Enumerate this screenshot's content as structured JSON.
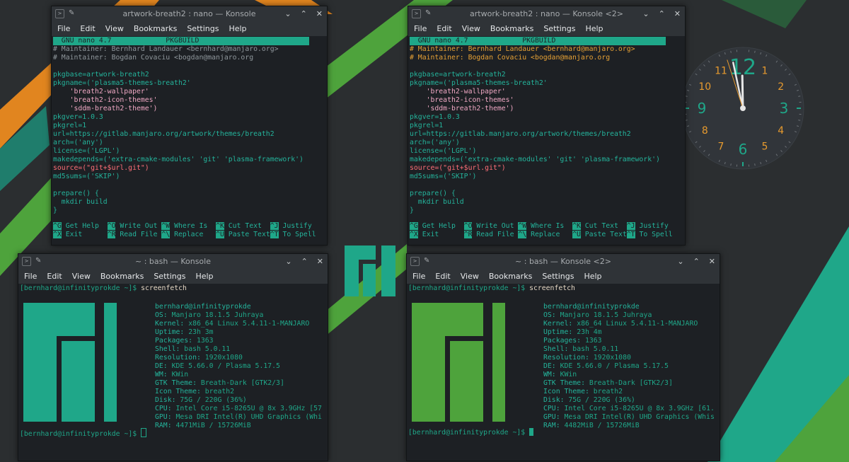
{
  "colors": {
    "teal": "#1fa789",
    "green": "#4ea33c",
    "orange": "#e1851f",
    "dark_bg": "#2b2e30",
    "terminal_bg": "#1d2024",
    "clock_orange": "#e79a2e"
  },
  "windows": [
    {
      "id": "nano1",
      "title": "artwork-breath2 : nano — Konsole",
      "menu": [
        "File",
        "Edit",
        "View",
        "Bookmarks",
        "Settings",
        "Help"
      ],
      "nano_header": "  GNU nano 4.7             PKGBUILD",
      "lines": [
        "# Maintainer: Bernhard Landauer <bernhard@manjaro.org>",
        "# Maintainer: Bogdan Covaciu <bogdan@manjaro.org",
        "",
        "pkgbase=artwork-breath2",
        "pkgname=('plasma5-themes-breath2'",
        "    'breath2-wallpaper'",
        "    'breath2-icon-themes'",
        "    'sddm-breath2-theme')",
        "pkgver=1.0.3",
        "pkgrel=1",
        "url=https://gitlab.manjaro.org/artwork/themes/breath2",
        "arch=('any')",
        "license=('LGPL')",
        "makedepends=('extra-cmake-modules' 'git' 'plasma-framework')",
        "source=(\"git+$url.git\")",
        "md5sums=('SKIP')",
        "",
        "prepare() {",
        "  mkdir build",
        "}"
      ],
      "shortcuts_row1": [
        [
          "^G",
          "Get Help"
        ],
        [
          "^O",
          "Write Out"
        ],
        [
          "^W",
          "Where Is"
        ],
        [
          "^K",
          "Cut Text"
        ],
        [
          "^J",
          "Justify"
        ]
      ],
      "shortcuts_row2": [
        [
          "^X",
          "Exit"
        ],
        [
          "^R",
          "Read File"
        ],
        [
          "^\\",
          "Replace"
        ],
        [
          "^U",
          "Paste Text"
        ],
        [
          "^T",
          "To Spell"
        ]
      ]
    },
    {
      "id": "nano2",
      "title": "artwork-breath2 : nano — Konsole <2>",
      "menu": [
        "File",
        "Edit",
        "View",
        "Bookmarks",
        "Settings",
        "Help"
      ],
      "nano_header": "  GNU nano 4.7             PKGBUILD",
      "lines": [
        "# Maintainer: Bernhard Landauer <bernhard@manjaro.org>",
        "# Maintainer: Bogdan Covaciu <bogdan@manjaro.org",
        "",
        "pkgbase=artwork-breath2",
        "pkgname=('plasma5-themes-breath2'",
        "    'breath2-wallpaper'",
        "    'breath2-icon-themes'",
        "    'sddm-breath2-theme')",
        "pkgver=1.0.3",
        "pkgrel=1",
        "url=https://gitlab.manjaro.org/artwork/themes/breath2",
        "arch=('any')",
        "license=('LGPL')",
        "makedepends=('extra-cmake-modules' 'git' 'plasma-framework')",
        "source=(\"git+$url.git\")",
        "md5sums=('SKIP')",
        "",
        "prepare() {",
        "  mkdir build",
        "}"
      ],
      "shortcuts_row1": [
        [
          "^G",
          "Get Help"
        ],
        [
          "^O",
          "Write Out"
        ],
        [
          "^W",
          "Where Is"
        ],
        [
          "^K",
          "Cut Text"
        ],
        [
          "^J",
          "Justify"
        ]
      ],
      "shortcuts_row2": [
        [
          "^X",
          "Exit"
        ],
        [
          "^R",
          "Read File"
        ],
        [
          "^\\",
          "Replace"
        ],
        [
          "^U",
          "Paste Text"
        ],
        [
          "^T",
          "To Spell"
        ]
      ]
    },
    {
      "id": "bash1",
      "title": "~ : bash — Konsole",
      "menu": [
        "File",
        "Edit",
        "View",
        "Bookmarks",
        "Settings",
        "Help"
      ],
      "prompt": "[bernhard@infinityprokde ~]$ ",
      "command": "screenfetch",
      "user_host": "bernhard@infinityprokde",
      "info": [
        [
          "OS: ",
          "Manjaro 18.1.5 Juhraya"
        ],
        [
          "Kernel: ",
          "x86_64 Linux 5.4.11-1-MANJARO"
        ],
        [
          "Uptime: ",
          "23h 3m"
        ],
        [
          "Packages: ",
          "1363"
        ],
        [
          "Shell: ",
          "bash 5.0.11"
        ],
        [
          "Resolution: ",
          "1920x1080"
        ],
        [
          "DE: ",
          "KDE 5.66.0 / Plasma 5.17.5"
        ],
        [
          "WM: ",
          "KWin"
        ],
        [
          "GTK Theme: ",
          "Breath-Dark [GTK2/3]"
        ],
        [
          "Icon Theme: ",
          "breath2"
        ],
        [
          "Disk: ",
          "75G / 220G (36%)"
        ],
        [
          "CPU: ",
          "Intel Core i5-8265U @ 8x 3.9GHz [57"
        ],
        [
          "GPU: ",
          "Mesa DRI Intel(R) UHD Graphics (Whi"
        ],
        [
          "RAM: ",
          "4471MiB / 15726MiB"
        ]
      ],
      "logo_color": "#1fa789"
    },
    {
      "id": "bash2",
      "title": "~ : bash — Konsole <2>",
      "menu": [
        "File",
        "Edit",
        "View",
        "Bookmarks",
        "Settings",
        "Help"
      ],
      "prompt": "[bernhard@infinityprokde ~]$ ",
      "command": "screenfetch",
      "user_host": "bernhard@infinityprokde",
      "info": [
        [
          "OS: ",
          "Manjaro 18.1.5 Juhraya"
        ],
        [
          "Kernel: ",
          "x86_64 Linux 5.4.11-1-MANJARO"
        ],
        [
          "Uptime: ",
          "23h 4m"
        ],
        [
          "Packages: ",
          "1363"
        ],
        [
          "Shell: ",
          "bash 5.0.11"
        ],
        [
          "Resolution: ",
          "1920x1080"
        ],
        [
          "DE: ",
          "KDE 5.66.0 / Plasma 5.17.5"
        ],
        [
          "WM: ",
          "KWin"
        ],
        [
          "GTK Theme: ",
          "Breath-Dark [GTK2/3]"
        ],
        [
          "Icon Theme: ",
          "breath2"
        ],
        [
          "Disk: ",
          "75G / 220G (36%)"
        ],
        [
          "CPU: ",
          "Intel Core i5-8265U @ 8x 3.9GHz [61."
        ],
        [
          "GPU: ",
          "Mesa DRI Intel(R) UHD Graphics (Whis"
        ],
        [
          "RAM: ",
          "4482MiB / 15726MiB"
        ]
      ],
      "logo_color": "#4ea33c"
    }
  ],
  "clock": {
    "numbers": [
      "12",
      "1",
      "2",
      "3",
      "4",
      "5",
      "6",
      "7",
      "8",
      "9",
      "10",
      "11"
    ],
    "hour": 11,
    "minute": 58,
    "second": 57
  }
}
